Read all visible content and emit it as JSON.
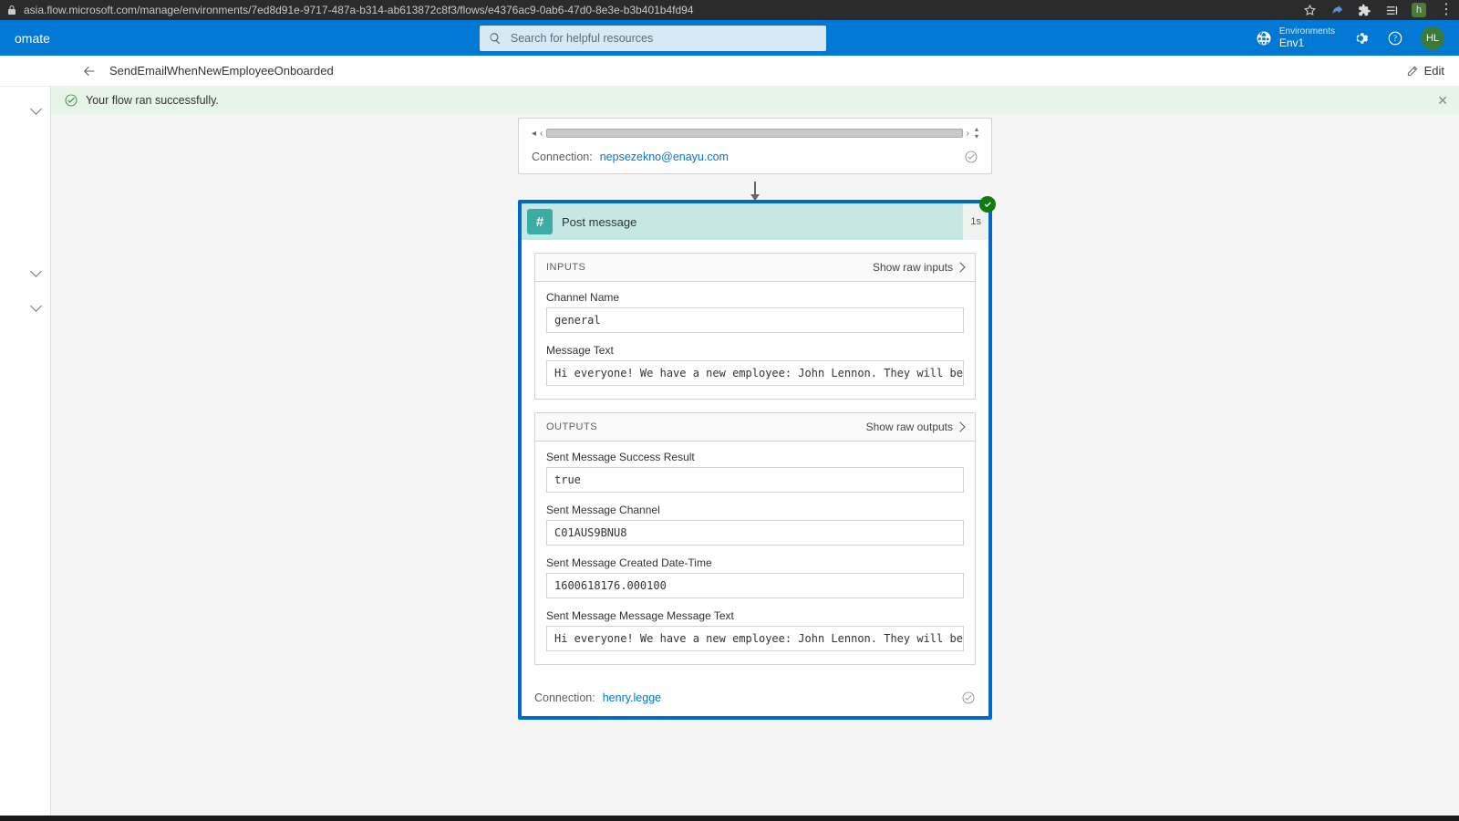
{
  "browser": {
    "url": "asia.flow.microsoft.com/manage/environments/7ed8d91e-9717-487a-b314-ab613872c8f3/flows/e4376ac9-0ab6-47d0-8e3e-b3b401b4fd94",
    "ext_badge": "h"
  },
  "topbar": {
    "brand": "omate",
    "search_placeholder": "Search for helpful resources",
    "env_label": "Environments",
    "env_name": "Env1",
    "avatar": "HL"
  },
  "cmdrow": {
    "title": "SendEmailWhenNewEmployeeOnboarded",
    "edit": "Edit"
  },
  "success": {
    "message": "Your flow ran successfully."
  },
  "partial_step": {
    "connection_label": "Connection:",
    "connection_value": "nepsezekno@enayu.com"
  },
  "step": {
    "title": "Post message",
    "duration": "1s",
    "inputs": {
      "header": "INPUTS",
      "show_raw": "Show raw inputs",
      "fields": {
        "channel_label": "Channel Name",
        "channel_value": "general",
        "message_label": "Message Text",
        "message_value": "Hi everyone! We have a new employee: John Lennon. They will be repo"
      }
    },
    "outputs": {
      "header": "OUTPUTS",
      "show_raw": "Show raw outputs",
      "fields": {
        "success_label": "Sent Message Success Result",
        "success_value": "true",
        "channel_label": "Sent Message Channel",
        "channel_value": "C01AUS9BNU8",
        "date_label": "Sent Message Created Date-Time",
        "date_value": "1600618176.000100",
        "text_label": "Sent Message Message Message Text",
        "text_value": "Hi everyone! We have a new employee: John Lennon. They will be repo"
      }
    },
    "connection_label": "Connection:",
    "connection_value": "henry.legge"
  }
}
